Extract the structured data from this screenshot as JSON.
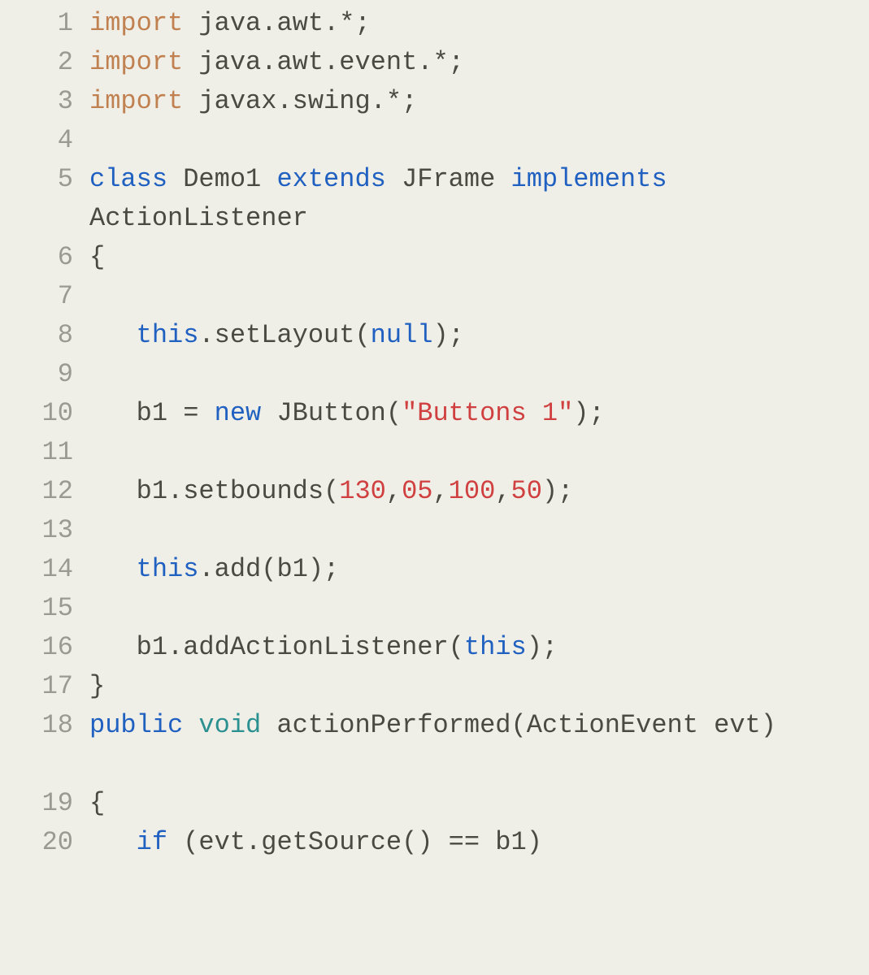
{
  "lines": [
    {
      "num": "1",
      "tokens": [
        [
          "kw",
          "import"
        ],
        [
          "txt",
          " java.awt.*;"
        ]
      ]
    },
    {
      "num": "2",
      "tokens": [
        [
          "kw",
          "import"
        ],
        [
          "txt",
          " java.awt.event.*;"
        ]
      ]
    },
    {
      "num": "3",
      "tokens": [
        [
          "kw",
          "import"
        ],
        [
          "txt",
          " javax.swing.*;"
        ]
      ]
    },
    {
      "num": "4",
      "tokens": []
    },
    {
      "num": "5",
      "tokens": [
        [
          "kw-blue",
          "class"
        ],
        [
          "txt",
          " Demo1 "
        ],
        [
          "kw-blue",
          "extends"
        ],
        [
          "txt",
          " JFrame "
        ],
        [
          "kw-blue",
          "implements"
        ],
        [
          "txt",
          " ActionListener"
        ]
      ],
      "tall": true
    },
    {
      "num": "6",
      "tokens": [
        [
          "txt",
          "{"
        ]
      ]
    },
    {
      "num": "7",
      "tokens": []
    },
    {
      "num": "8",
      "tokens": [
        [
          "txt",
          "   "
        ],
        [
          "kw-blue",
          "this"
        ],
        [
          "txt",
          ".setLayout("
        ],
        [
          "bool",
          "null"
        ],
        [
          "txt",
          ");"
        ]
      ]
    },
    {
      "num": "9",
      "tokens": []
    },
    {
      "num": "10",
      "tokens": [
        [
          "txt",
          "   b1 = "
        ],
        [
          "kw-blue",
          "new"
        ],
        [
          "txt",
          " JButton("
        ],
        [
          "str",
          "\"Buttons 1\""
        ],
        [
          "txt",
          ");"
        ]
      ]
    },
    {
      "num": "11",
      "tokens": []
    },
    {
      "num": "12",
      "tokens": [
        [
          "txt",
          "   b1.setbounds("
        ],
        [
          "num",
          "130"
        ],
        [
          "txt",
          ","
        ],
        [
          "num",
          "05"
        ],
        [
          "txt",
          ","
        ],
        [
          "num",
          "100"
        ],
        [
          "txt",
          ","
        ],
        [
          "num",
          "50"
        ],
        [
          "txt",
          ");"
        ]
      ]
    },
    {
      "num": "13",
      "tokens": []
    },
    {
      "num": "14",
      "tokens": [
        [
          "txt",
          "   "
        ],
        [
          "kw-blue",
          "this"
        ],
        [
          "txt",
          ".add(b1);"
        ]
      ]
    },
    {
      "num": "15",
      "tokens": []
    },
    {
      "num": "16",
      "tokens": [
        [
          "txt",
          "   b1.addActionListener("
        ],
        [
          "kw-blue",
          "this"
        ],
        [
          "txt",
          ");"
        ]
      ]
    },
    {
      "num": "17",
      "tokens": [
        [
          "txt",
          "}"
        ]
      ]
    },
    {
      "num": "18",
      "tokens": [
        [
          "kw-blue",
          "public"
        ],
        [
          "txt",
          " "
        ],
        [
          "type",
          "void"
        ],
        [
          "txt",
          " actionPerformed(ActionEvent evt)"
        ]
      ],
      "tall": true
    },
    {
      "num": "19",
      "tokens": [
        [
          "txt",
          "{"
        ]
      ]
    },
    {
      "num": "20",
      "tokens": [
        [
          "txt",
          "   "
        ],
        [
          "kw-blue",
          "if"
        ],
        [
          "txt",
          " (evt.getSource() == b1)"
        ]
      ]
    }
  ]
}
